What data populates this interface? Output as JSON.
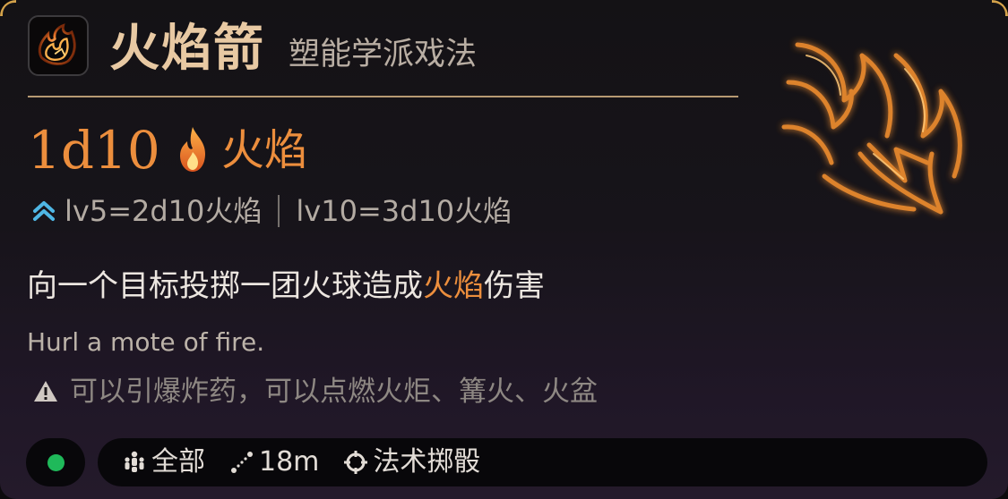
{
  "spell": {
    "name": "火焰箭",
    "school": "塑能学派戏法",
    "damage_dice": "1d10",
    "damage_type": "火焰",
    "upcast": {
      "level5": "lv5=2d10火焰",
      "level10": "lv10=3d10火焰"
    },
    "description": {
      "before": "向一个目标投掷一团火球造成",
      "highlight": "火焰",
      "after": "伤害"
    },
    "flavor": "Hurl a mote of fire.",
    "warning": "可以引爆炸药，可以点燃火炬、篝火、火盆"
  },
  "properties": {
    "target": "全部",
    "range": "18m",
    "roll": "法术掷骰"
  },
  "status": {
    "color": "#1fb95a"
  },
  "colors": {
    "accent_fire": "#ec8e3d",
    "title_gold": "#e8c9a3",
    "divider": "#b79a72",
    "upcast_icon": "#4fb6e4"
  },
  "icons": {
    "spell": "fire-bolt-icon",
    "damage_type": "flame-icon",
    "upcast": "chevrons-up-icon",
    "warning": "warning-triangle-icon",
    "target": "people-icon",
    "range": "range-line-icon",
    "roll": "crosshair-icon"
  }
}
